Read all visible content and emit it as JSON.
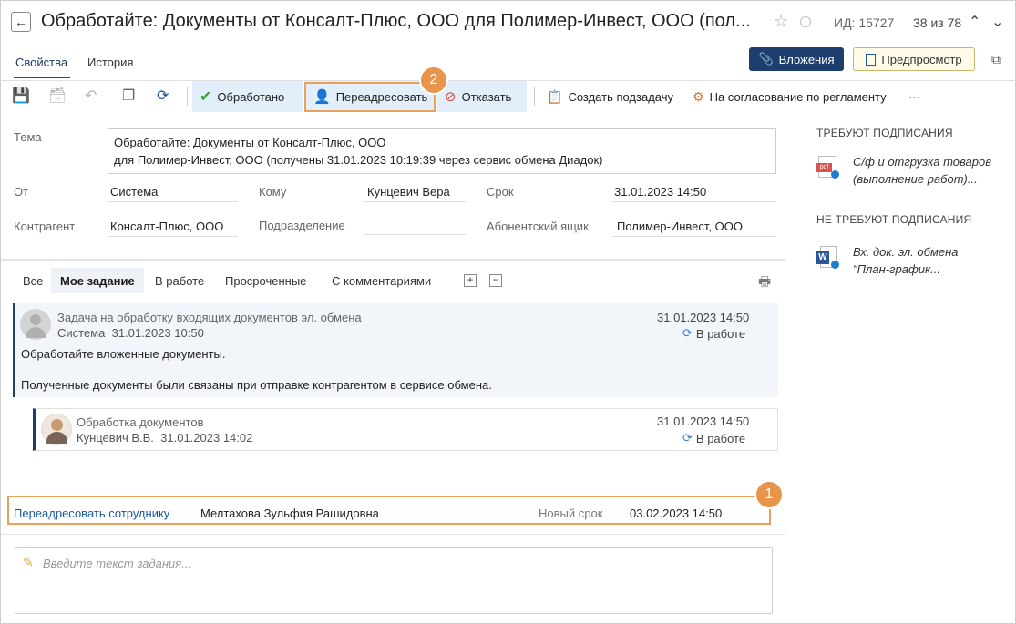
{
  "header": {
    "title": "Обработайте: Документы от Консалт-Плюс, ООО для Полимер-Инвест, ООО   (пол...",
    "id_label": "ИД: 15727",
    "counter": "38 из 78"
  },
  "tabs": {
    "properties": "Свойства",
    "history": "История"
  },
  "buttons": {
    "attachments": "Вложения",
    "preview": "Предпросмотр"
  },
  "toolbar": {
    "done": "Обработано",
    "forward": "Переадресовать",
    "reject": "Отказать",
    "subtask": "Создать подзадачу",
    "approval": "На согласование по регламенту",
    "more": "···"
  },
  "callouts": {
    "one": "1",
    "two": "2"
  },
  "form": {
    "subject_label": "Тема",
    "subject_line1": "Обработайте: Документы от Консалт-Плюс, ООО",
    "subject_line2": "для Полимер-Инвест, ООО (получены 31.01.2023 10:19:39 через сервис обмена Диадок)",
    "from_label": "От",
    "from_value": "Система",
    "to_label": "Кому",
    "to_value": "Кунцевич Вера",
    "deadline_label": "Срок",
    "deadline_value": "31.01.2023 14:50",
    "counterparty_label": "Контрагент",
    "counterparty_value": "Консалт-Плюс, ООО",
    "department_label": "Подразделение",
    "department_value": "",
    "mailbox_label": "Абонентский ящик",
    "mailbox_value": "Полимер-Инвест, ООО"
  },
  "filters": [
    "Все",
    "Мое задание",
    "В работе",
    "Просроченные",
    "С комментариями"
  ],
  "cards": [
    {
      "title": "Задача на обработку входящих документов эл. обмена",
      "author": "Система",
      "created": "31.01.2023 10:50",
      "date": "31.01.2023 14:50",
      "status": "В работе",
      "text1": "Обработайте вложенные документы.",
      "text2": "Полученные документы были связаны при отправке контрагентом в сервисе обмена."
    },
    {
      "title": "Обработка документов",
      "author": "Кунцевич В.В.",
      "created": "31.01.2023 14:02",
      "date": "31.01.2023 14:50",
      "status": "В работе"
    }
  ],
  "forward": {
    "link": "Переадресовать сотруднику",
    "employee": "Мелтахова Зульфия Рашидовна",
    "new_deadline_label": "Новый срок",
    "new_deadline_value": "03.02.2023 14:50"
  },
  "task_input": {
    "placeholder": "Введите текст задания..."
  },
  "right_panel": {
    "sign_required": "ТРЕБУЮТ ПОДПИСАНИЯ",
    "doc1_line1": "С/ф и отгрузка товаров",
    "doc1_line2": "(выполнение работ)...",
    "doc1_icon": "pdf",
    "sign_not_required": "НЕ ТРЕБУЮТ ПОДПИСАНИЯ",
    "doc2_line1": "Вх. док. эл. обмена",
    "doc2_line2": "\"План-график...",
    "doc2_icon": "W"
  },
  "colors": {
    "accent": "#1e3f6e",
    "callout": "#e8944a",
    "link": "#1a5a9a"
  }
}
